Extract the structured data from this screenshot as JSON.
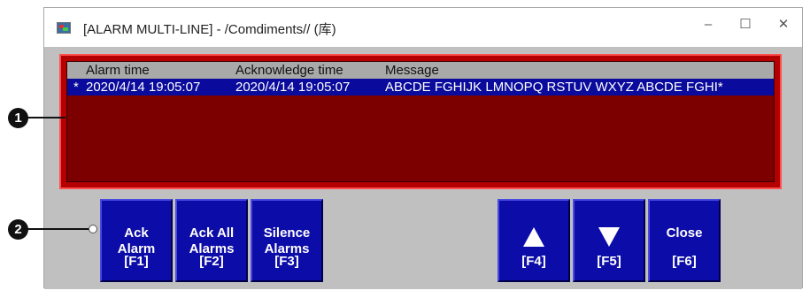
{
  "window": {
    "title": "[ALARM MULTI-LINE] - /Comdiments// (库)",
    "minimize": "–",
    "maximize": "☐",
    "close": "✕"
  },
  "alarm_grid": {
    "columns": [
      "Alarm time",
      "Acknowledge time",
      "Message"
    ],
    "rows": [
      {
        "marker": "*",
        "alarm_time": "2020/4/14 19:05:07",
        "ack_time": "2020/4/14 19:05:07",
        "message": "ABCDE FGHIJK LMNOPQ RSTUV WXYZ ABCDE FGHI*"
      }
    ]
  },
  "buttons": {
    "ack_alarm": {
      "line1": "Ack",
      "line2": "Alarm",
      "key": "[F1]"
    },
    "ack_all": {
      "line1": "Ack All",
      "line2": "Alarms",
      "key": "[F2]"
    },
    "silence": {
      "line1": "Silence",
      "line2": "Alarms",
      "key": "[F3]"
    },
    "up": {
      "key": "[F4]",
      "icon": "arrow-up-icon"
    },
    "down": {
      "key": "[F5]",
      "icon": "arrow-down-icon"
    },
    "close": {
      "label": "Close",
      "key": "[F6]"
    }
  },
  "callouts": [
    "1",
    "2"
  ],
  "colors": {
    "alarm_panel": "#b40000",
    "alarm_inner": "#7c0000",
    "selected_row": "#0a0a9c",
    "button": "#0c0ca8"
  }
}
